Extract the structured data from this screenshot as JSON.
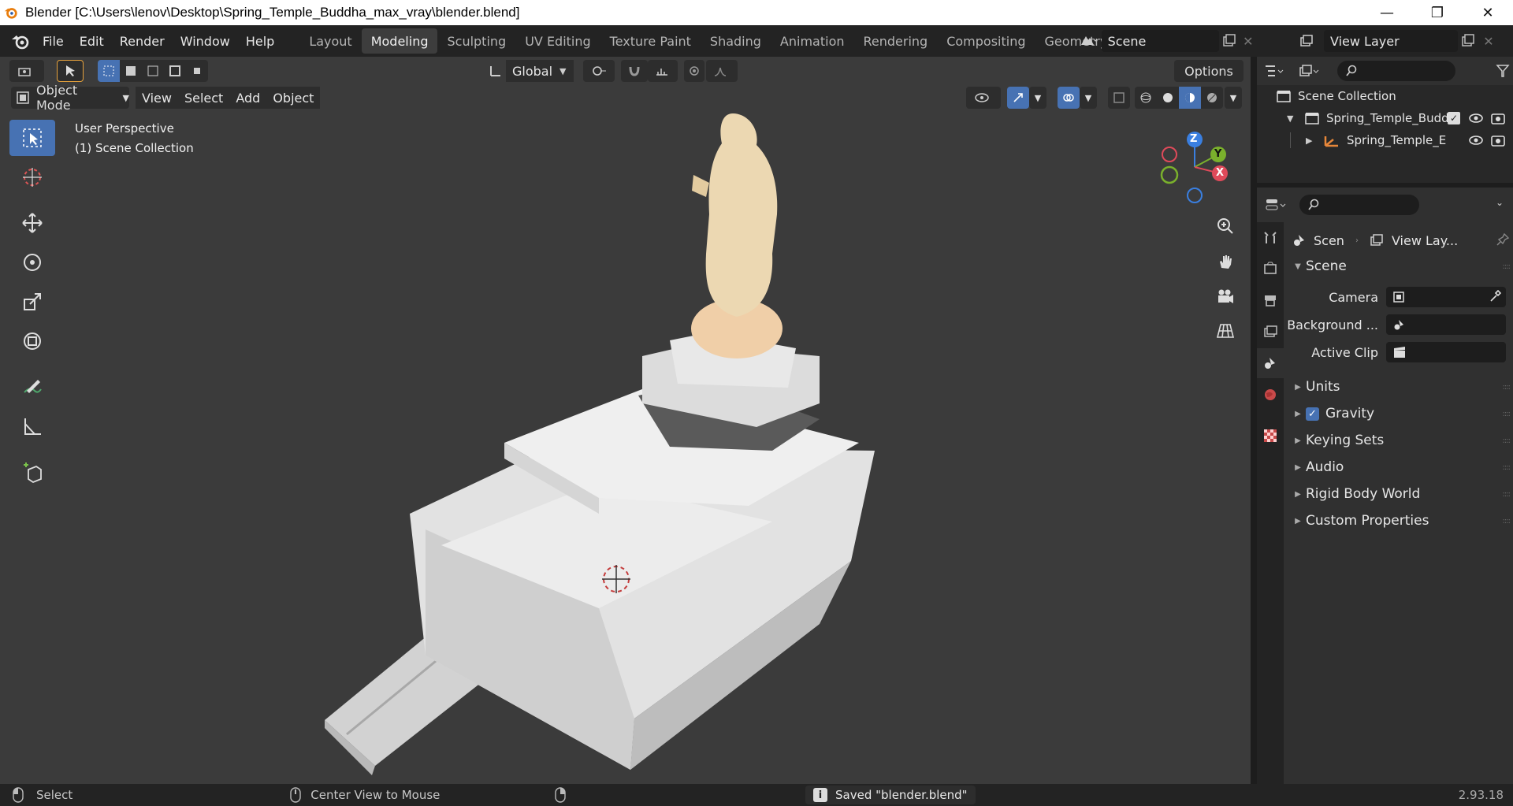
{
  "window": {
    "title": "Blender [C:\\Users\\lenov\\Desktop\\Spring_Temple_Buddha_max_vray\\blender.blend]",
    "minimize": "—",
    "maximize": "❐",
    "close": "✕"
  },
  "menu": [
    "File",
    "Edit",
    "Render",
    "Window",
    "Help"
  ],
  "workspaces": [
    "Layout",
    "Modeling",
    "Sculpting",
    "UV Editing",
    "Texture Paint",
    "Shading",
    "Animation",
    "Rendering",
    "Compositing",
    "Geometry Nod"
  ],
  "active_workspace": "Modeling",
  "scene_name": "Scene",
  "view_layer": "View Layer",
  "viewport": {
    "transform_orientation": "Global",
    "options_label": "Options",
    "mode": "Object Mode",
    "header_menus": [
      "View",
      "Select",
      "Add",
      "Object"
    ],
    "perspective_label": "User Perspective",
    "collection_label": "(1) Scene Collection",
    "gizmo_axes": {
      "z": "Z",
      "y": "Y",
      "x": "X"
    }
  },
  "outliner": {
    "root": "Scene Collection",
    "items": [
      {
        "label": "Spring_Temple_Budd"
      },
      {
        "label": "Spring_Temple_E"
      }
    ]
  },
  "properties": {
    "breadcrumb_scene": "Scen",
    "breadcrumb_viewlayer": "View Lay...",
    "panel_title": "Scene",
    "fields": [
      {
        "label": "Camera"
      },
      {
        "label": "Background ..."
      },
      {
        "label": "Active Clip"
      }
    ],
    "panels": [
      "Units",
      "Gravity",
      "Keying Sets",
      "Audio",
      "Rigid Body World",
      "Custom Properties"
    ],
    "gravity_checked": true
  },
  "status": {
    "select": "Select",
    "center_view": "Center View to Mouse",
    "saved_message": "Saved \"blender.blend\"",
    "version": "2.93.18"
  },
  "colors": {
    "accent_blue": "#4772b3",
    "axis_x": "#e04a5a",
    "axis_y": "#7ab02c",
    "axis_z": "#3a7fe0",
    "statue": "#e8d2a8",
    "orange_object": "#e8873a"
  }
}
